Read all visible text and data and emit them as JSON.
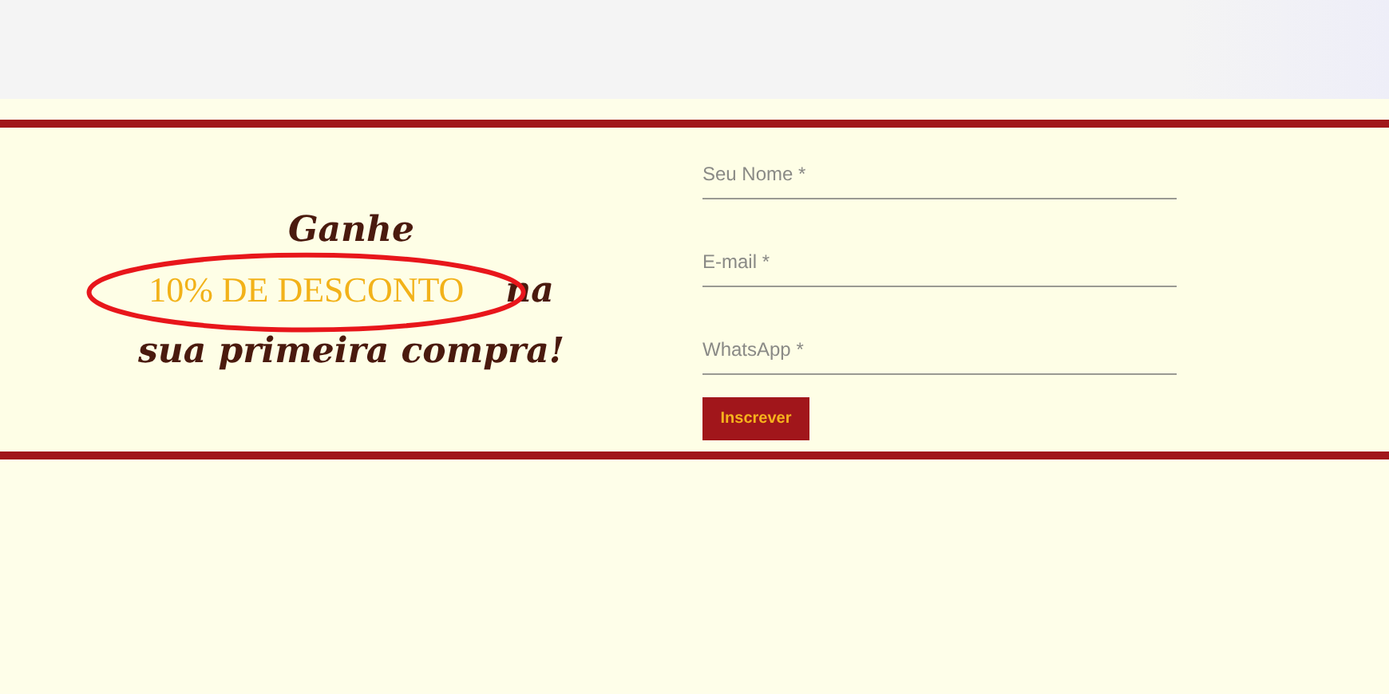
{
  "promo": {
    "line_1": "Ganhe",
    "highlight": "10% DE DESCONTO",
    "line_2_end": "na",
    "line_3": "sua primeira compra!"
  },
  "form": {
    "fields": [
      {
        "placeholder": "Seu Nome *"
      },
      {
        "placeholder": "E-mail *"
      },
      {
        "placeholder": "WhatsApp *"
      }
    ],
    "submit": "Inscrever"
  }
}
